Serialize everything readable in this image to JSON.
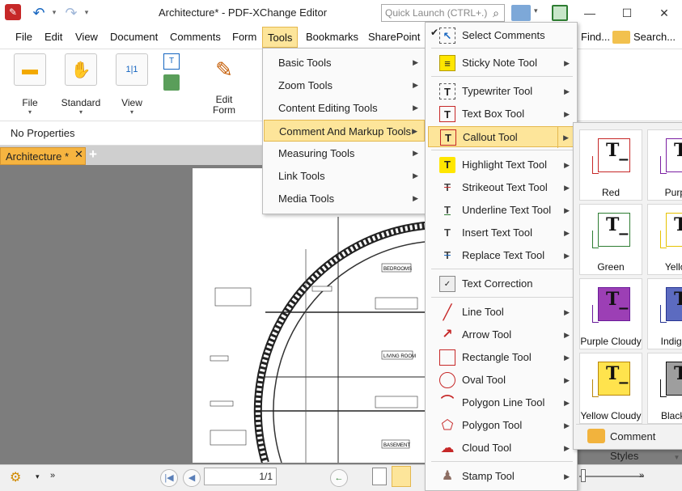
{
  "window": {
    "title": "Architecture* - PDF-XChange Editor",
    "quick_launch_placeholder": "Quick Launch (CTRL+.)",
    "minimize": "—",
    "maximize": "☐",
    "close": "✕"
  },
  "menubar": [
    "File",
    "Edit",
    "View",
    "Document",
    "Comments",
    "Form",
    "Tools",
    "Bookmarks",
    "SharePoint"
  ],
  "menubar_right": {
    "find": "Find...",
    "search": "Search..."
  },
  "ribbon": {
    "file": "File",
    "standard": "Standard",
    "view": "View",
    "edit_form_line1": "Edit",
    "edit_form_line2": "Form"
  },
  "properties": {
    "label": "No Properties"
  },
  "tabs": {
    "document": "Architecture *",
    "add": "+",
    "close": "✕"
  },
  "status": {
    "page_value": "1/1"
  },
  "tools_menu": [
    "Basic Tools",
    "Zoom Tools",
    "Content Editing Tools",
    "Comment And Markup Tools",
    "Measuring Tools",
    "Link Tools",
    "Media Tools"
  ],
  "markup_menu": {
    "select_comments": "Select Comments",
    "sticky_note": "Sticky Note Tool",
    "typewriter": "Typewriter Tool",
    "text_box": "Text Box Tool",
    "callout": "Callout Tool",
    "highlight": "Highlight Text Tool",
    "strikeout": "Strikeout Text Tool",
    "underline": "Underline Text Tool",
    "insert_text": "Insert Text Tool",
    "replace_text": "Replace Text Tool",
    "text_correction": "Text Correction",
    "line": "Line Tool",
    "arrow": "Arrow Tool",
    "rectangle": "Rectangle Tool",
    "oval": "Oval Tool",
    "polygon_line": "Polygon Line Tool",
    "polygon": "Polygon Tool",
    "cloud": "Cloud Tool",
    "stamp": "Stamp Tool"
  },
  "callout_styles": [
    {
      "label": "Red",
      "color": "#c62828",
      "fill": "#ffffff"
    },
    {
      "label": "Purple",
      "color": "#7b1fa2",
      "fill": "#ffffff"
    },
    {
      "label": "Green",
      "color": "#2e7d32",
      "fill": "#ffffff"
    },
    {
      "label": "Yellow",
      "color": "#e6c200",
      "fill": "#ffffff"
    },
    {
      "label": "Purple Cloudy",
      "color": "#6a1b9a",
      "fill": "#9c3fb5"
    },
    {
      "label": "Indigo C",
      "color": "#283593",
      "fill": "#5c6bc0"
    },
    {
      "label": "Yellow Cloudy",
      "color": "#b8860b",
      "fill": "#ffe34d"
    },
    {
      "label": "Black Cl",
      "color": "#111111",
      "fill": "#9e9e9e"
    }
  ],
  "comment_styles_label": "Comment Styles",
  "drawing_labels": [
    "BEDROOMS",
    "LIVING ROOM",
    "BASEMENT"
  ],
  "accent": "#fde59a"
}
